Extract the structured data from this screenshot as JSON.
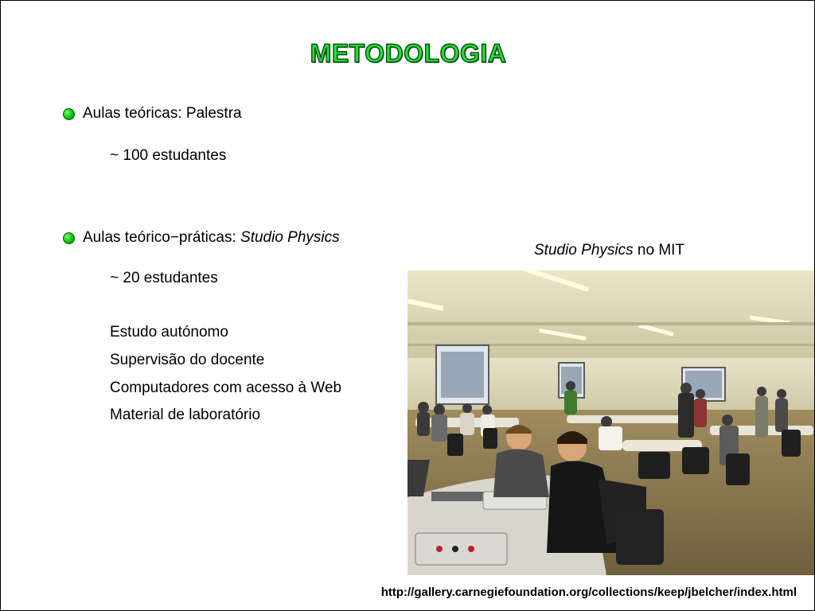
{
  "title": "METODOLOGIA",
  "bullets": [
    {
      "label": "Aulas teóricas: Palestra",
      "sub": "~ 100 estudantes"
    },
    {
      "label_prefix": "Aulas teórico−práticas: ",
      "label_em": "Studio Physics",
      "sub": "~ 20 estudantes",
      "items": [
        "Estudo autónomo",
        "Supervisão do docente",
        "Computadores com acesso à Web",
        "Material de laboratório"
      ]
    }
  ],
  "photo": {
    "caption_em": "Studio Physics",
    "caption_rest": " no MIT"
  },
  "source_url": "http://gallery.carnegiefoundation.org/collections/keep/jbelcher/index.html",
  "colors": {
    "title_fill": "#22e03a",
    "title_outline": "#0a4d10",
    "bullet": "#10d010"
  }
}
